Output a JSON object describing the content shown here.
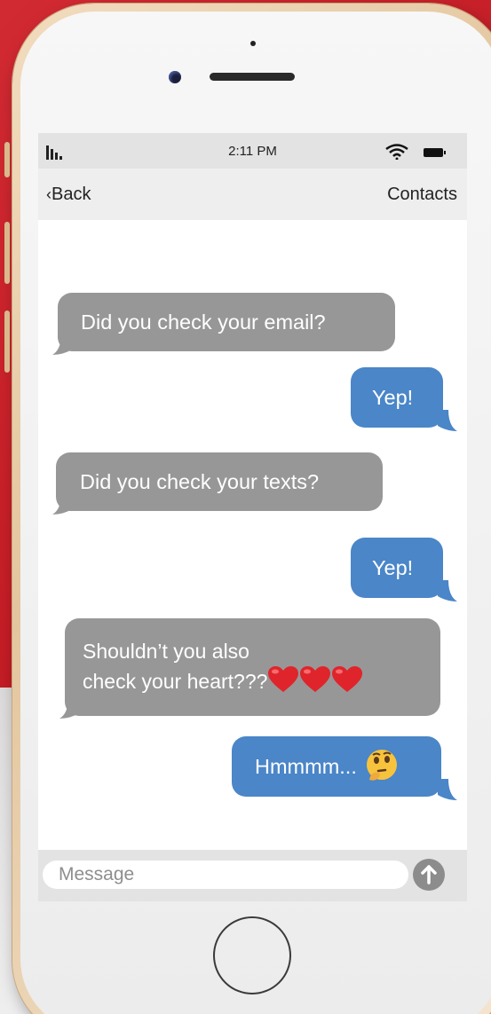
{
  "status_bar": {
    "time": "2:11 PM",
    "signal_icon": "signal-bars-icon",
    "wifi_icon": "wifi-icon",
    "battery_icon": "battery-icon"
  },
  "nav": {
    "back_label": "Back",
    "contacts_label": "Contacts"
  },
  "messages": [
    {
      "direction": "incoming",
      "text": "Did you check your email?"
    },
    {
      "direction": "outgoing",
      "text": "Yep!"
    },
    {
      "direction": "incoming",
      "text": "Did you check your texts?"
    },
    {
      "direction": "outgoing",
      "text": "Yep!"
    },
    {
      "direction": "incoming",
      "line1": "Shouldn’t you also",
      "line2": "check your heart???",
      "emoji": "red-heart-emoji x3"
    },
    {
      "direction": "outgoing",
      "text": "Hmmmm...",
      "emoji": "thinking-face-emoji"
    }
  ],
  "composer": {
    "placeholder": "Message",
    "send_icon": "arrow-up-icon"
  },
  "colors": {
    "background_red": "#c8222b",
    "incoming_bubble": "#979797",
    "outgoing_bubble": "#4a86c8",
    "phone_frame": "#ebd0ad"
  }
}
